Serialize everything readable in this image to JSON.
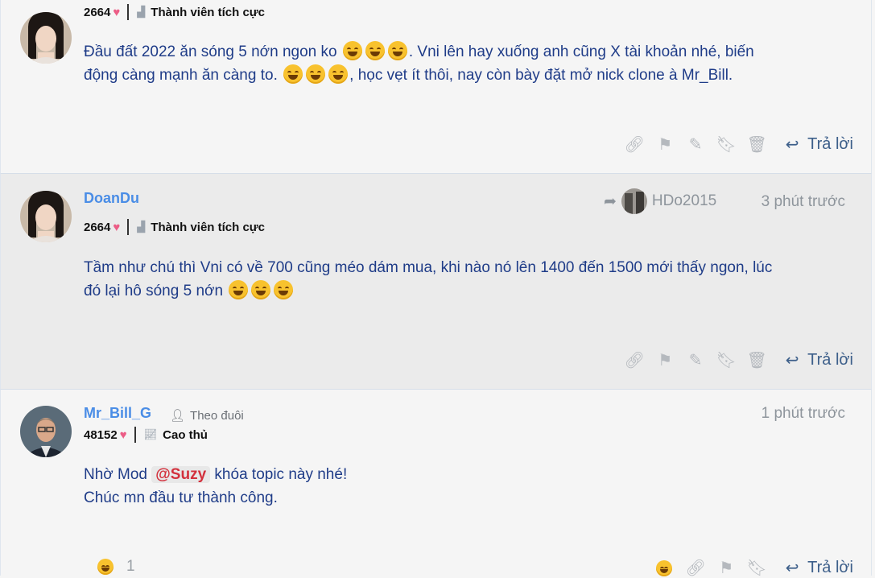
{
  "posts": [
    {
      "author": "",
      "count": "2664",
      "rank": "Thành viên tích cực",
      "content_line1_a": "Đầu đất 2022 ăn sóng 5 nớn ngon ko ",
      "content_line1_b": ". Vni lên hay xuống anh cũng X tài khoản nhé, biến",
      "content_line2_a": "động càng mạnh ăn càng to. ",
      "content_line2_b": ", học vẹt ít thôi, nay còn bày đặt mở nick clone à Mr_Bill.",
      "reply_label": "Trả lời"
    },
    {
      "author": "DoanDu",
      "count": "2664",
      "rank": "Thành viên tích cực",
      "shared_by": "HDo2015",
      "time": "3 phút trước",
      "content_line1": "Tầm như chú thì Vni có về 700 cũng méo dám mua, khi nào nó lên 1400 đến 1500 mới thấy ngon, lúc",
      "content_line2": "đó lại hô sóng 5 nớn ",
      "reply_label": "Trả lời"
    },
    {
      "author": "Mr_Bill_G",
      "follow_label": "Theo đuôi",
      "count": "48152",
      "rank": "Cao thủ",
      "time": "1 phút trước",
      "content_line1_a": "Nhờ Mod ",
      "mention": "@Suzy",
      "content_line1_b": " khóa topic này nhé!",
      "content_line2": "Chúc mn đầu tư thành công.",
      "reaction_count": "1",
      "reply_label": "Trả lời"
    }
  ],
  "icons": [
    "link-icon",
    "flag-icon",
    "pencil-icon",
    "bookmark-icon",
    "trash-icon",
    "reply-icon",
    "share-icon",
    "heart-icon",
    "rank-icon",
    "follow-icon",
    "emoji-icon"
  ],
  "colors": {
    "username": "#4a8de6",
    "content": "#1f3c88",
    "heart": "#ec5d86",
    "mention": "#d3303c"
  }
}
